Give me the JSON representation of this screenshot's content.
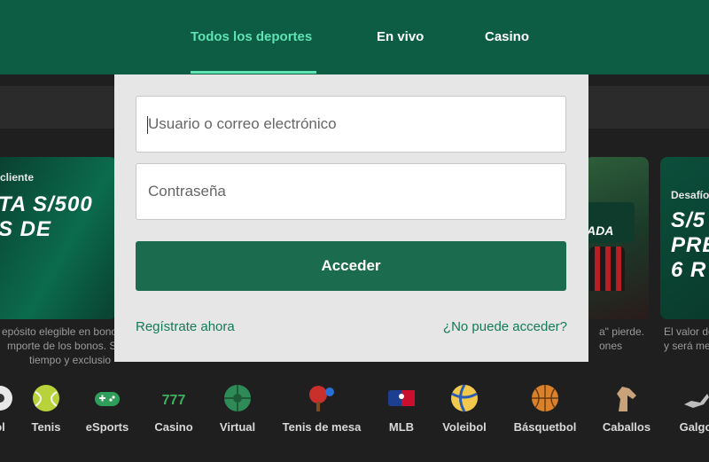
{
  "nav": {
    "tabs": [
      {
        "label": "Todos los deportes",
        "active": true
      },
      {
        "label": "En vivo",
        "active": false
      },
      {
        "label": "Casino",
        "active": false
      }
    ]
  },
  "promos": {
    "left": {
      "tag": "cliente",
      "headline_1": "TA S/500",
      "headline_2": "S DE",
      "caption_1": "epósito elegible en bono",
      "caption_2": "mporte de los bonos. Se",
      "caption_3": "tiempo y exclusio"
    },
    "middle": {
      "badge": "ADA",
      "caption_1": "a\" pierde.",
      "caption_2": "ones"
    },
    "right": {
      "tag": "Desafío",
      "headline_1": "S/5",
      "headline_2": "PRE",
      "headline_3": "6 R",
      "caption_1": "El valor de",
      "caption_2": "y será me"
    }
  },
  "sports": [
    {
      "label": "ol",
      "icon": "soccer-icon"
    },
    {
      "label": "Tenis",
      "icon": "tennis-icon"
    },
    {
      "label": "eSports",
      "icon": "gamepad-icon"
    },
    {
      "label": "Casino",
      "icon": "slots-777-icon"
    },
    {
      "label": "Virtual",
      "icon": "virtual-ball-icon"
    },
    {
      "label": "Tenis de mesa",
      "icon": "table-tennis-icon"
    },
    {
      "label": "MLB",
      "icon": "mlb-logo-icon"
    },
    {
      "label": "Voleibol",
      "icon": "volleyball-icon"
    },
    {
      "label": "Básquetbol",
      "icon": "basketball-icon"
    },
    {
      "label": "Caballos",
      "icon": "horse-icon"
    },
    {
      "label": "Galgo",
      "icon": "greyhound-icon"
    }
  ],
  "login": {
    "username_placeholder": "Usuario o correo electrónico",
    "username_value": "",
    "password_placeholder": "Contraseña",
    "password_value": "",
    "submit_label": "Acceder",
    "register_link": "Regístrate ahora",
    "help_link": "¿No puede acceder?"
  },
  "colors": {
    "brand_green": "#0d5c44",
    "active_tab": "#5fe3b3",
    "button_green": "#1b6b4e",
    "link_green": "#137a58"
  }
}
